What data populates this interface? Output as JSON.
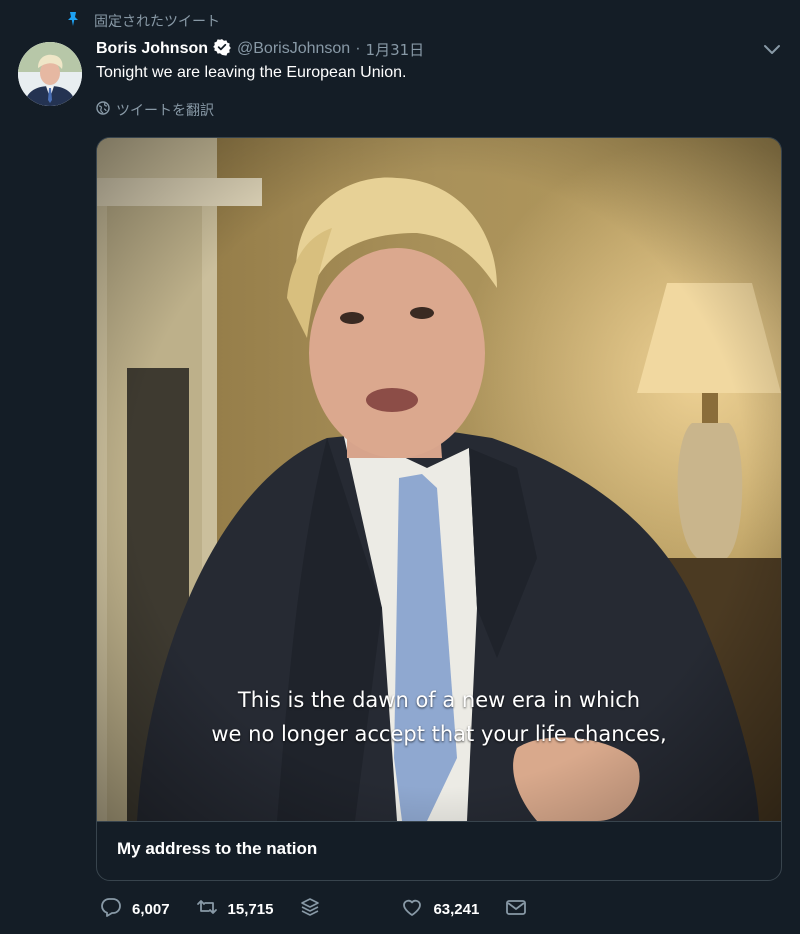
{
  "pinned": {
    "label": "固定されたツイート",
    "icon": "pin-icon"
  },
  "tweet": {
    "author_name": "Boris Johnson",
    "handle": "@BorisJohnson",
    "separator": "·",
    "date": "1月31日",
    "text": "Tonight we are leaving the European Union.",
    "translate_label": "ツイートを翻訳"
  },
  "video": {
    "subtitle_line1": "This is the dawn of a new era in which",
    "subtitle_line2": "we no longer accept that your life chances,"
  },
  "card": {
    "title": "My address to the nation"
  },
  "actions": {
    "replies": "6,007",
    "retweets": "15,715",
    "likes": "63,241"
  },
  "colors": {
    "background": "#141d26",
    "secondary_text": "#8899a6",
    "border": "#38444d",
    "verified": "#ffffff"
  }
}
